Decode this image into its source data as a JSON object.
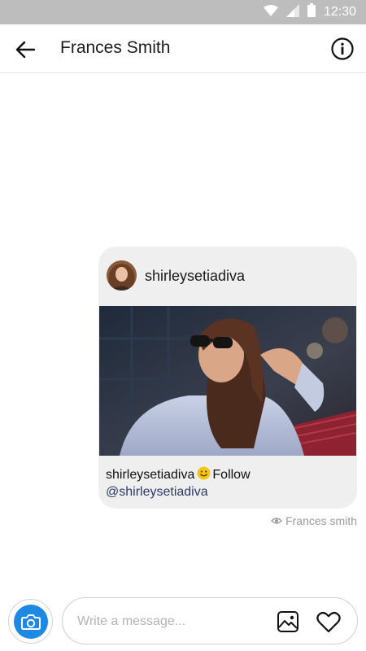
{
  "status_bar": {
    "time": "12:30",
    "icons": [
      "wifi-icon",
      "signal-icon",
      "battery-icon"
    ]
  },
  "header": {
    "title": "Frances Smith",
    "back_icon": "arrow-left-icon",
    "info_icon": "info-icon"
  },
  "shared_post": {
    "username": "shirleysetiadiva",
    "caption_user": "shirleysetiadiva",
    "caption_text": "Follow",
    "mention": "@shirleysetiadiva",
    "emoji": "smiley-emoji"
  },
  "seen_by": "Frances smith",
  "composer": {
    "placeholder": "Write a message...",
    "camera_icon": "camera-icon",
    "gallery_icon": "image-icon",
    "like_icon": "heart-icon"
  },
  "colors": {
    "status_bar": "#bdbdbd",
    "accent": "#1e88e5",
    "bubble": "#efefef",
    "mention": "#2b3a67"
  }
}
